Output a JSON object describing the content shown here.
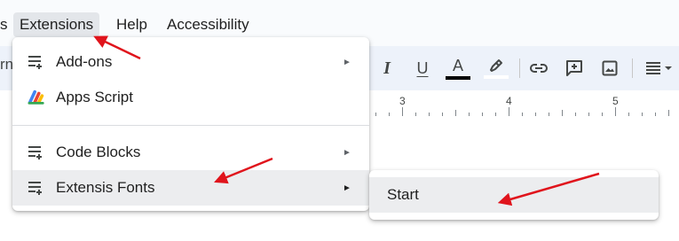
{
  "menubar": {
    "partial_left": "s",
    "extensions": "Extensions",
    "help": "Help",
    "accessibility": "Accessibility"
  },
  "toolbar": {
    "partial_left": "rn",
    "italic": "I",
    "underline": "U",
    "text_color": "A",
    "text_color_swatch": "#000000",
    "highlight_icon": "highlighter-icon",
    "link_icon": "link-icon",
    "comment_icon": "add-comment-icon",
    "image_icon": "insert-image-icon",
    "align_icon": "align-justify-icon"
  },
  "ruler": {
    "labels": [
      "3",
      "4",
      "5"
    ]
  },
  "menu": {
    "items": [
      {
        "label": "Add-ons",
        "icon": "add-ons-icon",
        "submenu": true
      },
      {
        "label": "Apps Script",
        "icon": "apps-script-icon",
        "submenu": false
      },
      {
        "label": "Code Blocks",
        "icon": "add-ons-icon",
        "submenu": true
      },
      {
        "label": "Extensis Fonts",
        "icon": "add-ons-icon",
        "submenu": true
      }
    ],
    "arrow": "►"
  },
  "submenu": {
    "items": [
      {
        "label": "Start"
      }
    ]
  },
  "annotation_color": "#e0141c"
}
